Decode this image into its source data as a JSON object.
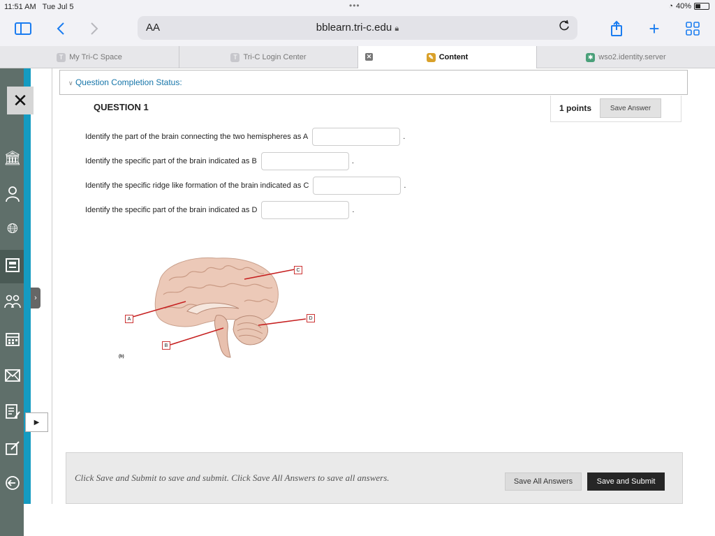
{
  "status": {
    "time": "11:51 AM",
    "date": "Tue Jul 5",
    "battery": "40%",
    "battery_level": 0.4
  },
  "browser": {
    "text_size_label": "AA",
    "url": "bblearn.tri-c.edu",
    "icons": [
      "sidebar-icon",
      "back-icon",
      "forward-icon",
      "lock-icon",
      "reload-icon",
      "share-icon",
      "new-tab-icon",
      "tabs-overview-icon"
    ]
  },
  "tabs": [
    {
      "label": "My Tri-C Space",
      "favicon": "T",
      "active": false
    },
    {
      "label": "Tri-C Login Center",
      "favicon": "T",
      "active": false
    },
    {
      "label": "Content",
      "favicon": "",
      "active": true
    },
    {
      "label": "wso2.identity.server",
      "favicon": "",
      "active": false
    }
  ],
  "sidebar": {
    "icons": [
      "close-icon",
      "institution-icon",
      "profile-icon",
      "globe-icon",
      "courses-icon",
      "groups-icon",
      "calendar-icon",
      "messages-icon",
      "grades-icon",
      "tools-icon",
      "sign-out-icon"
    ]
  },
  "question": {
    "status_label": "Question Completion Status:",
    "title": "QUESTION 1",
    "points": "1 points",
    "save_answer": "Save Answer",
    "prompts": [
      {
        "text": "Identify the part of the brain connecting the two hemispheres as A",
        "value": ""
      },
      {
        "text": "Identify the specific part of the brain indicated as B",
        "value": ""
      },
      {
        "text": "Identify the specific ridge like formation of the brain indicated as C",
        "value": ""
      },
      {
        "text": "Identify the specific part of the brain indicated as D",
        "value": ""
      }
    ],
    "figure_labels": [
      "A",
      "B",
      "C",
      "D"
    ],
    "figure_caption": "(b)"
  },
  "footer": {
    "instruction": "Click Save and Submit to save and submit. Click Save All Answers to save all answers.",
    "save_all": "Save All Answers",
    "save_submit": "Save and Submit"
  }
}
